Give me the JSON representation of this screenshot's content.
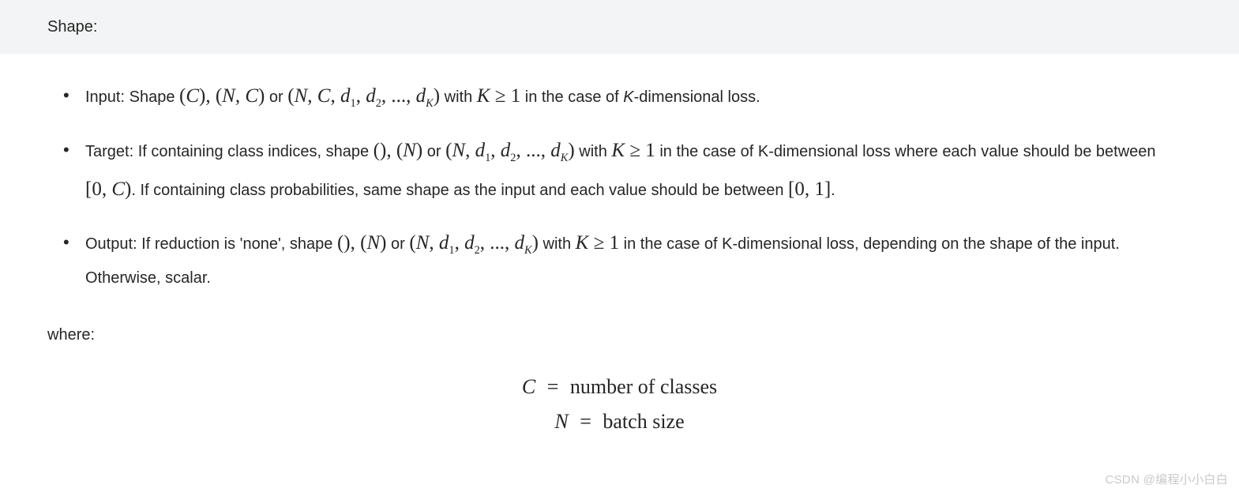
{
  "header": {
    "title": "Shape:"
  },
  "bullets": {
    "input": {
      "label": "Input:",
      "t1": " Shape ",
      "m1_open": "(",
      "m1_C": "C",
      "m1_close": ")",
      "sep1": ", ",
      "m2_open": "(",
      "m2_N": "N",
      "m2_comma": ", ",
      "m2_C": "C",
      "m2_close": ")",
      "t2": " or ",
      "m3_open": "(",
      "m3_N": "N",
      "m3_c1": ", ",
      "m3_C": "C",
      "m3_c2": ", ",
      "m3_d": "d",
      "m3_s1": "1",
      "m3_c3": ", ",
      "m3_d2": "d",
      "m3_s2": "2",
      "m3_c4": ", ..., ",
      "m3_d3": "d",
      "m3_sK": "K",
      "m3_close": ")",
      "t3": " with ",
      "mK": "K",
      "geq": " ≥ ",
      "one": "1",
      "t4": " in the case of ",
      "kital": "K",
      "t5": "-dimensional loss."
    },
    "target": {
      "label": "Target:",
      "t1": " If containing class indices, shape ",
      "m1": "()",
      "sep1": ", ",
      "m2_open": "(",
      "m2_N": "N",
      "m2_close": ")",
      "t2": " or ",
      "m3_open": "(",
      "m3_N": "N",
      "m3_c1": ", ",
      "m3_d": "d",
      "m3_s1": "1",
      "m3_c2": ", ",
      "m3_d2": "d",
      "m3_s2": "2",
      "m3_c3": ", ..., ",
      "m3_d3": "d",
      "m3_sK": "K",
      "m3_close": ")",
      "t3": " with ",
      "mK": "K",
      "geq": " ≥ ",
      "one": "1",
      "t4": " in the case of K-dimensional loss where each value should be between ",
      "rng1_open": "[",
      "rng1_0": "0",
      "rng1_c": ", ",
      "rng1_C": "C",
      "rng1_close": ")",
      "t5": ". If containing class probabilities, same shape as the input and each value should be between ",
      "rng2_open": "[",
      "rng2_0": "0",
      "rng2_c": ", ",
      "rng2_1": "1",
      "rng2_close": "]",
      "t6": "."
    },
    "output": {
      "label": "Output:",
      "t1": " If reduction is 'none', shape ",
      "m1": "()",
      "sep1": ", ",
      "m2_open": "(",
      "m2_N": "N",
      "m2_close": ")",
      "t2": " or ",
      "m3_open": "(",
      "m3_N": "N",
      "m3_c1": ", ",
      "m3_d": "d",
      "m3_s1": "1",
      "m3_c2": ", ",
      "m3_d2": "d",
      "m3_s2": "2",
      "m3_c3": ", ..., ",
      "m3_d3": "d",
      "m3_sK": "K",
      "m3_close": ")",
      "t3": " with ",
      "mK": "K",
      "geq": " ≥ ",
      "one": "1",
      "t4": " in the case of K-dimensional loss, depending on the shape of the input. Otherwise, scalar."
    }
  },
  "where": {
    "label": "where:"
  },
  "equations": {
    "line1": {
      "var": "C",
      "eq": "=",
      "text": "number of classes"
    },
    "line2": {
      "var": "N",
      "eq": "=",
      "text": "batch size"
    }
  },
  "watermark": "CSDN @编程小小白白"
}
